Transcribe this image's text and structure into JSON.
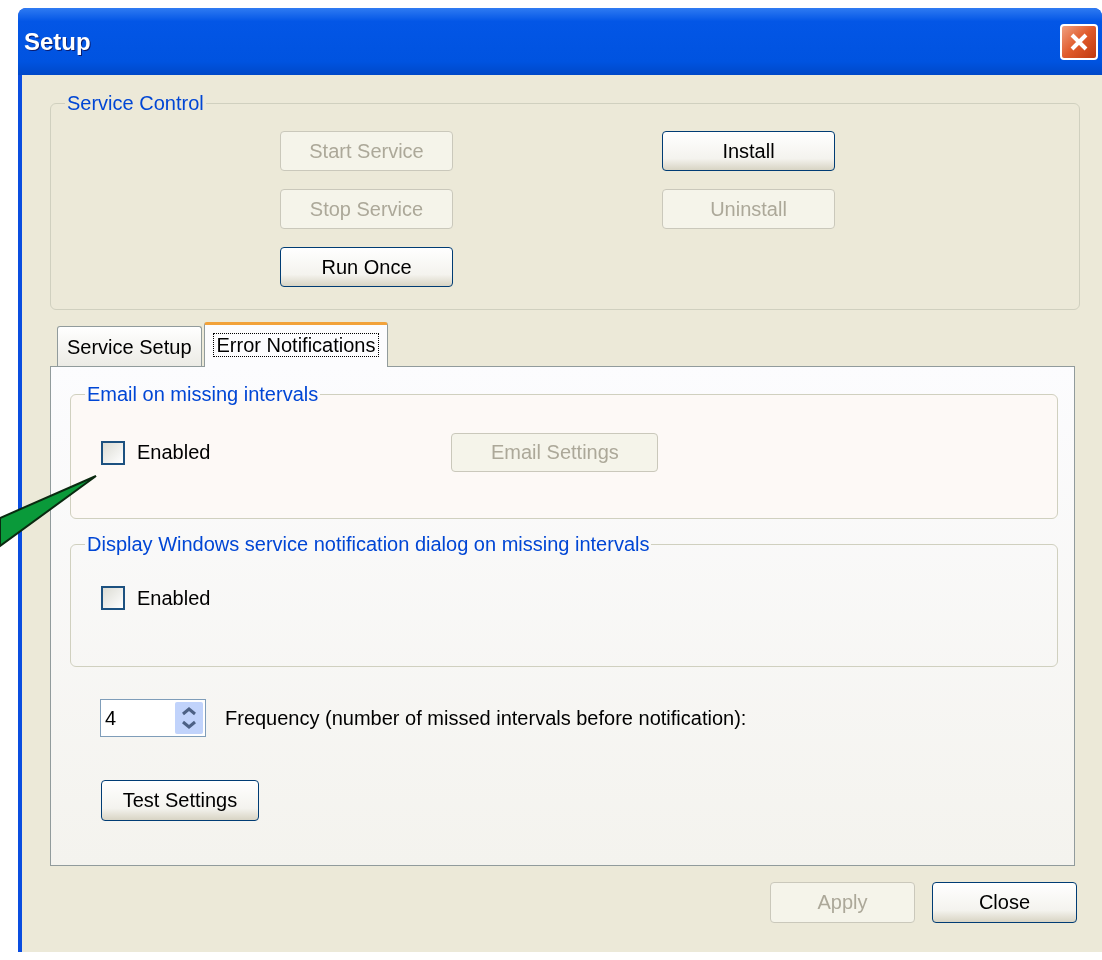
{
  "window": {
    "title": "Setup"
  },
  "service_control": {
    "title": "Service Control",
    "buttons": [
      {
        "label": "Start Service",
        "disabled": true
      },
      {
        "label": "Install",
        "disabled": false
      },
      {
        "label": "Stop Service",
        "disabled": true
      },
      {
        "label": "Uninstall",
        "disabled": true
      },
      {
        "label": "Run Once",
        "disabled": false
      }
    ]
  },
  "tabs": [
    {
      "label": "Service Setup",
      "selected": false
    },
    {
      "label": "Error Notifications",
      "selected": true
    }
  ],
  "email_group": {
    "title": "Email on missing intervals",
    "checkbox": {
      "label": "Enabled",
      "checked": false
    },
    "button": {
      "label": "Email Settings",
      "disabled": true
    }
  },
  "dialog_group": {
    "title": "Display Windows service notification dialog on missing intervals",
    "checkbox": {
      "label": "Enabled",
      "checked": false
    }
  },
  "frequency": {
    "value": "4",
    "label": "Frequency (number of missed intervals before notification):"
  },
  "test_button": {
    "label": "Test Settings",
    "disabled": false
  },
  "buttons": [
    {
      "label": "Apply",
      "disabled": true
    },
    {
      "label": "Close",
      "disabled": false
    }
  ]
}
